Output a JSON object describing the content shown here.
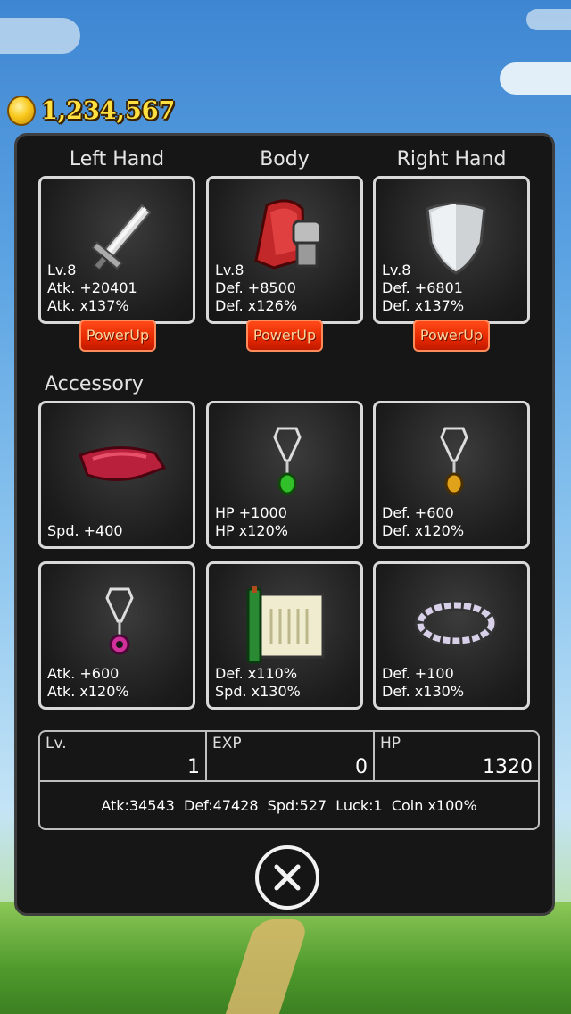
{
  "coins": {
    "value": "1,234,567",
    "icon": "gold-coin-icon"
  },
  "equipment": {
    "left_hand": {
      "label": "Left Hand",
      "icon": "sword-icon",
      "stats": [
        "Lv.8",
        "Atk. +20401",
        "Atk. x137%"
      ],
      "button": "PowerUp"
    },
    "body": {
      "label": "Body",
      "icon": "armor-icon",
      "stats": [
        "Lv.8",
        "Def. +8500",
        "Def. x126%"
      ],
      "button": "PowerUp"
    },
    "right_hand": {
      "label": "Right Hand",
      "icon": "shield-icon",
      "stats": [
        "Lv.8",
        "Def. +6801",
        "Def. x137%"
      ],
      "button": "PowerUp"
    }
  },
  "accessory": {
    "label": "Accessory",
    "items": [
      {
        "icon": "bandana-icon",
        "stats": [
          "Spd. +400"
        ]
      },
      {
        "icon": "green-pendant-icon",
        "stats": [
          "HP +1000",
          "HP x120%"
        ]
      },
      {
        "icon": "yellow-pendant-icon",
        "stats": [
          "Def. +600",
          "Def. x120%"
        ]
      },
      {
        "icon": "pink-pendant-icon",
        "stats": [
          "Atk. +600",
          "Atk. x120%"
        ]
      },
      {
        "icon": "scroll-icon",
        "stats": [
          "Def. x110%",
          "Spd. x130%"
        ]
      },
      {
        "icon": "bracelet-icon",
        "stats": [
          "Def. +100",
          "Def. x130%"
        ]
      }
    ]
  },
  "status": {
    "lv_label": "Lv.",
    "lv_value": "1",
    "exp_label": "EXP",
    "exp_value": "0",
    "hp_label": "HP",
    "hp_value": "1320",
    "summary": "Atk:34543  Def:47428  Spd:527  Luck:1  Coin x100%"
  },
  "close_icon": "close-icon",
  "colors": {
    "panel": "#161616",
    "powerup": "#e52800",
    "coin_text": "#ffe040"
  }
}
